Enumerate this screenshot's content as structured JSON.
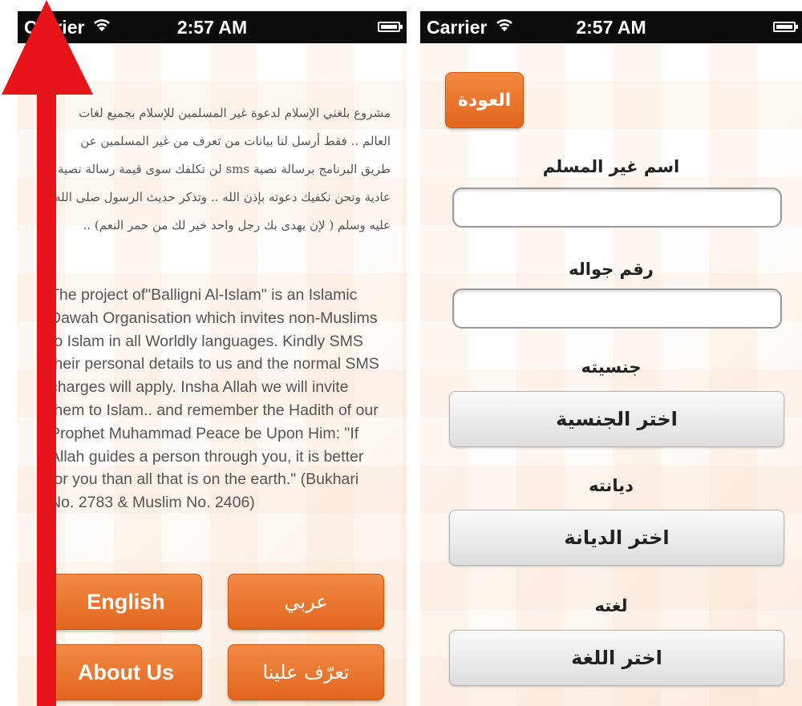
{
  "left_screen": {
    "status": {
      "carrier": "Carrier",
      "wifi": "wifi-icon",
      "time": "2:57 AM",
      "battery": "battery-icon"
    },
    "arabic_text": "مشروع بلغني الإسلام لدعوة غير المسلمين للإسلام بجميع لغات العالم .. فقط أرسل لنا بيانات من تعرف من غير المسلمين عن طريق البرنامج برسالة نصية sms لن تكلفك سوى قيمة رسالة نصية عادية ونحن نكفيك دعوته بإذن الله .. وتذكر حديث الرسول صلى الله عليه وسلم ( لإن يهدى بك رجل واحد خير لك من حمر النعم) ..",
    "english_text": "The project of\"Balligni Al-Islam\" is an Islamic Dawah Organisation which invites non-Muslims to Islam in all Worldly languages. Kindly SMS their personal details to us and the normal SMS charges will apply. Insha Allah we will invite them to Islam.. and remember the Hadith of our Prophet Muhammad Peace be Upon Him: \"If Allah guides a person through you, it is better for you than all that is on the earth.\" (Bukhari No. 2783 & Muslim No. 2406)",
    "buttons": {
      "english": "English",
      "arabic": "عربي",
      "about_us": "About Us",
      "taaruf": "تعرّف علينا"
    }
  },
  "right_screen": {
    "status": {
      "carrier": "Carrier",
      "wifi": "wifi-icon",
      "time": "2:57 AM",
      "battery": "battery-icon"
    },
    "back_label": "العودة",
    "name_label": "اسم غير المسلم",
    "name_value": "",
    "mobile_label": "رقم جواله",
    "mobile_value": "",
    "nationality_label": "جنسيته",
    "nationality_select": "اختر الجنسية",
    "religion_label": "ديانته",
    "religion_select": "اختر الديانة",
    "language_label": "لغته",
    "language_select": "اختر اللغة"
  },
  "overlay": {
    "arrow": "up-arrow-icon",
    "arrow_color": "#e8141a"
  },
  "colors": {
    "accent_orange": "#e8702a",
    "status_bar": "#0c0c0c"
  }
}
